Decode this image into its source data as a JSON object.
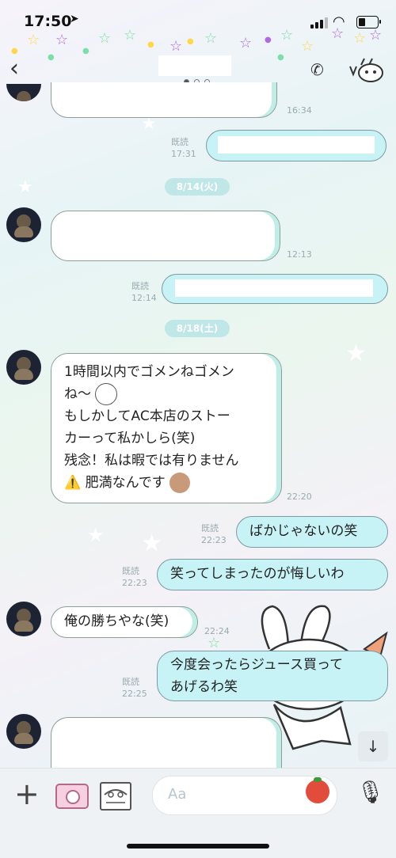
{
  "status_bar": {
    "time": "17:50",
    "location_glyph": "➤",
    "wifi_glyph": "◠"
  },
  "header": {
    "back_glyph": "‹",
    "call_glyph": "✆"
  },
  "colors": {
    "bubble_right": "#c7f3f6",
    "date_badge": "#bfe7e8",
    "star_yellow": "#ffd84a",
    "star_green": "#7be0a8",
    "star_purple": "#b06be0"
  },
  "messages": {
    "m1": {
      "time": "16:34"
    },
    "m2": {
      "read": "既読",
      "time": "17:31"
    },
    "date1": "8/14(火)",
    "m3": {
      "time": "12:13"
    },
    "m4": {
      "read": "既読",
      "time": "12:14"
    },
    "date2": "8/18(土)",
    "m5": {
      "lines": [
        "1時間以内でゴメンねゴメン",
        "ね〜",
        "もしかしてAC本店のストー",
        "カーって私かしら(笑)",
        "残念！私は暇では有りません",
        "肥満なんです"
      ],
      "warning_glyph": "⚠️",
      "time": "22:20"
    },
    "m6": {
      "text": "ばかじゃないの笑",
      "read": "既読",
      "time": "22:23"
    },
    "m7": {
      "text": "笑ってしまったのが悔しいわ",
      "read": "既読",
      "time": "22:23"
    },
    "m8": {
      "text": "俺の勝ちやな(笑)",
      "time": "22:24"
    },
    "m9": {
      "lines": [
        "今度会ったらジュース買って",
        "あげるわ笑"
      ],
      "read": "既読",
      "time": "22:25"
    }
  },
  "input": {
    "placeholder": "Aa"
  },
  "bottom_bar": {
    "plus_glyph": "+",
    "mic_glyph": "🎙",
    "scroll_glyph": "↓"
  },
  "icons": [
    "location-arrow-icon",
    "signal-icon",
    "wifi-icon",
    "battery-icon",
    "back-icon",
    "phone-icon",
    "menu-sticker-icon",
    "plus-icon",
    "camera-icon",
    "image-icon",
    "tomato-emoji-icon",
    "mic-icon",
    "scroll-down-icon"
  ]
}
